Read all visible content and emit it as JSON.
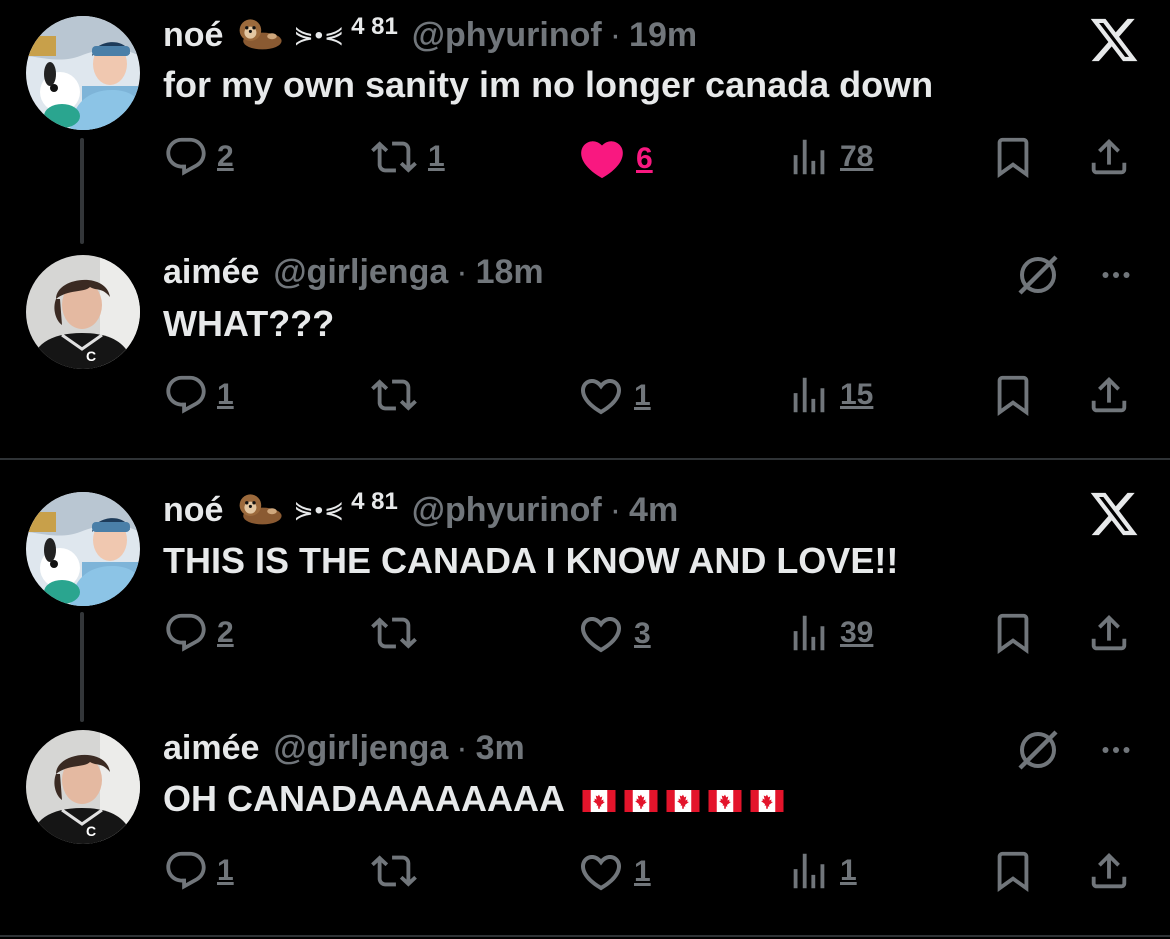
{
  "threads": [
    {
      "parent": {
        "name": "noé",
        "badge_text": "4 81",
        "handle": "@phyurinof",
        "time": "19m",
        "text": "for my own sanity im no longer canada down",
        "replies": "2",
        "reposts": "1",
        "likes": "6",
        "liked": true,
        "views": "78",
        "corner_icon": "x-logo-icon"
      },
      "reply": {
        "name": "aimée",
        "handle": "@girljenga",
        "time": "18m",
        "text": "WHAT???",
        "replies": "1",
        "reposts": "",
        "likes": "1",
        "liked": false,
        "views": "15",
        "corner_icon": "grok-icon"
      }
    },
    {
      "parent": {
        "name": "noé",
        "badge_text": "4 81",
        "handle": "@phyurinof",
        "time": "4m",
        "text": "THIS IS THE CANADA I KNOW AND LOVE!!",
        "replies": "2",
        "reposts": "",
        "likes": "3",
        "liked": false,
        "views": "39",
        "corner_icon": "x-logo-icon"
      },
      "reply": {
        "name": "aimée",
        "handle": "@girljenga",
        "time": "3m",
        "text": "OH CANADAAAAAAAA",
        "replies": "1",
        "reposts": "",
        "likes": "1",
        "liked": false,
        "views": "1",
        "corner_icon": "grok-icon"
      }
    }
  ],
  "separator": "·",
  "colors": {
    "background": "#000000",
    "text": "#e7e9ea",
    "muted": "#71767b",
    "like_active": "#f91880",
    "divider": "#2f3336"
  }
}
